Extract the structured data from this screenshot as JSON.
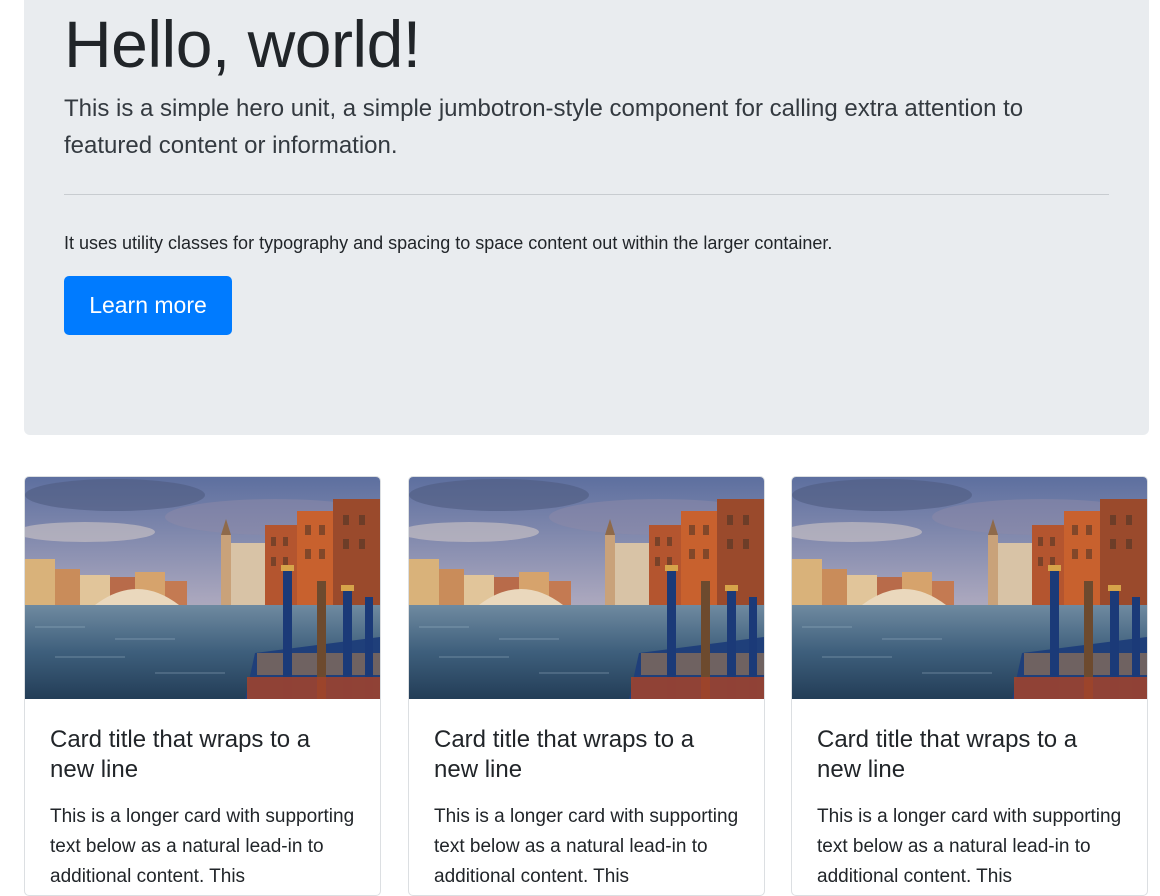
{
  "jumbotron": {
    "title": "Hello, world!",
    "lead": "This is a simple hero unit, a simple jumbotron-style component for calling extra attention to featured content or information.",
    "text": "It uses utility classes for typography and spacing to space content out within the larger container.",
    "button_label": "Learn more"
  },
  "cards": [
    {
      "title": "Card title that wraps to a new line",
      "text": "This is a longer card with supporting text below as a natural lead-in to additional content. This"
    },
    {
      "title": "Card title that wraps to a new line",
      "text": "This is a longer card with supporting text below as a natural lead-in to additional content. This"
    },
    {
      "title": "Card title that wraps to a new line",
      "text": "This is a longer card with supporting text below as a natural lead-in to additional content. This"
    }
  ],
  "colors": {
    "primary": "#007bff",
    "jumbotron_bg": "#e9ecef"
  }
}
